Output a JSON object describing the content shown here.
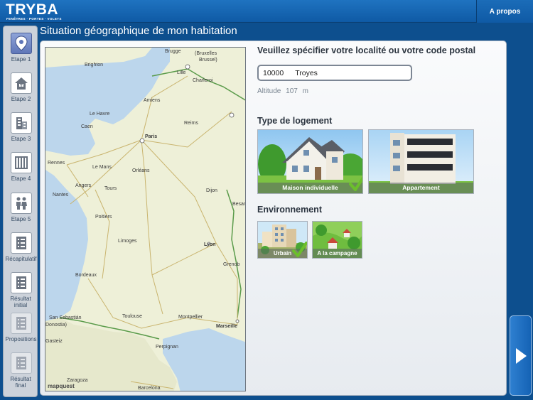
{
  "header": {
    "logo_text": "TRYBA",
    "logo_tagline": "FENÊTRES · PORTES · VOLETS",
    "about_label": "A propos"
  },
  "page": {
    "title": "Situation géographique de mon habitation"
  },
  "sidebar": {
    "items": [
      {
        "label": "Etape 1",
        "icon": "location-pin-icon",
        "active": true
      },
      {
        "label": "Etape 2",
        "icon": "house-icon"
      },
      {
        "label": "Etape 3",
        "icon": "building-icon"
      },
      {
        "label": "Etape 4",
        "icon": "window-icon"
      },
      {
        "label": "Etape 5",
        "icon": "people-icon"
      },
      {
        "label": "Récapitulatif",
        "icon": "checklist-icon"
      },
      {
        "label": "Résultat initial",
        "icon": "checklist-icon"
      },
      {
        "label": "Propositions",
        "icon": "checklist-icon",
        "dimmed": true
      },
      {
        "label": "Résultat final",
        "icon": "checklist-icon",
        "dimmed": true
      }
    ]
  },
  "location": {
    "heading": "Veuillez spécifier votre localité ou votre code postal",
    "postal_code": "10000",
    "city": "Troyes",
    "altitude_label": "Altitude",
    "altitude_value": "107",
    "altitude_unit": "m"
  },
  "housing": {
    "heading": "Type de logement",
    "options": [
      {
        "label": "Maison individuelle",
        "selected": true
      },
      {
        "label": "Appartement",
        "selected": false
      }
    ]
  },
  "environment": {
    "heading": "Environnement",
    "options": [
      {
        "label": "Urbain",
        "selected": true
      },
      {
        "label": "A la campagne",
        "selected": false
      }
    ]
  },
  "map": {
    "cities": [
      "Brighton",
      "Brugge",
      "Bruxelles",
      "Brussel",
      "Charleroi",
      "Lille",
      "Amiens",
      "Le Havre",
      "Reims",
      "Caen",
      "Paris",
      "Rennes",
      "Le Mans",
      "Orléans",
      "Angers",
      "Tours",
      "Nantes",
      "Dijon",
      "Besanço",
      "Poitiers",
      "Limoges",
      "Lyon",
      "Grenob",
      "Bordeaux",
      "Montpellier",
      "Toulouse",
      "Marseille",
      "San Sebastián",
      "Donostia",
      "Perpignan",
      "Gasteiz",
      "Zaragoza",
      "Barcelona",
      "mapquest"
    ],
    "colors": {
      "land": "#eef0d8",
      "sea": "#bcd6ec",
      "road": "#c9b46e",
      "border": "#5a9b4a"
    }
  },
  "colors": {
    "brand_blue": "#0f5aa5",
    "accent_green": "#6bbf2c"
  }
}
